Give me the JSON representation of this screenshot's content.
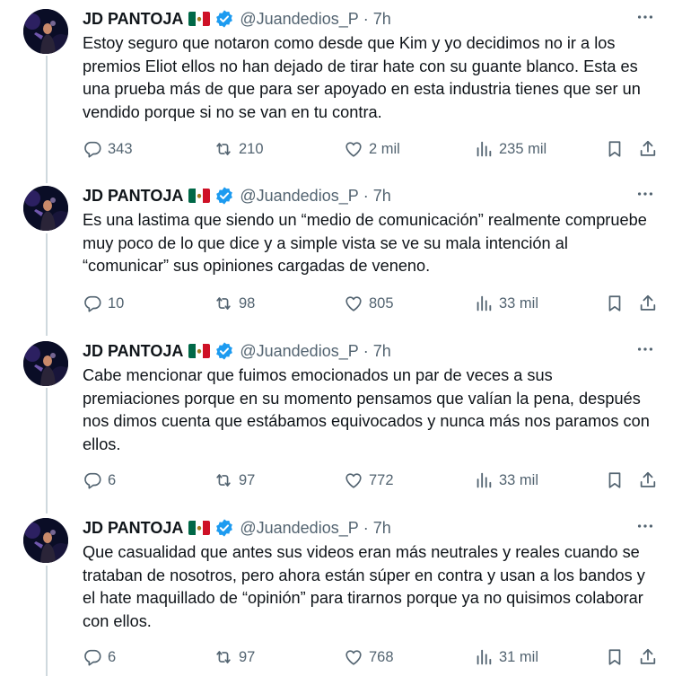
{
  "author": {
    "name": "JD PANTOJA",
    "handle": "@Juandedios_P",
    "separator": "·",
    "flag_icon": "mexico-flag-icon",
    "verified_icon": "verified-badge-icon",
    "verified_color": "#1d9bf0"
  },
  "icons": {
    "more": "more-options-icon",
    "reply": "reply-icon",
    "retweet": "retweet-icon",
    "like": "like-icon",
    "views": "views-icon",
    "bookmark": "bookmark-icon",
    "share": "share-icon"
  },
  "tweets": [
    {
      "time": "7h",
      "text": "Estoy seguro que notaron como desde que Kim y yo decidimos no ir a los premios Eliot ellos no han dejado de tirar hate con su guante blanco. Esta es una prueba más de que para ser apoyado en esta industria tienes que ser un vendido porque si no se van en tu contra.",
      "replies": "343",
      "retweets": "210",
      "likes": "2 mil",
      "views": "235 mil"
    },
    {
      "time": "7h",
      "text": "Es una lastima que siendo un “medio de comunicación” realmente compruebe muy poco de lo que dice y a simple vista se ve su mala intención al “comunicar” sus opiniones cargadas de veneno.",
      "replies": "10",
      "retweets": "98",
      "likes": "805",
      "views": "33 mil"
    },
    {
      "time": "7h",
      "text": "Cabe mencionar que fuimos emocionados un par de veces a sus premiaciones porque en su momento pensamos que valían la pena, después nos dimos cuenta que estábamos equivocados y nunca más nos paramos con ellos.",
      "replies": "6",
      "retweets": "97",
      "likes": "772",
      "views": "33 mil"
    },
    {
      "time": "7h",
      "text": "Que casualidad que antes sus videos eran más neutrales y reales cuando se trataban de nosotros, pero ahora están súper en contra y usan a los bandos y el hate maquillado de “opinión” para tirarnos porque ya no quisimos colaborar con ellos.",
      "replies": "6",
      "retweets": "97",
      "likes": "768",
      "views": "31 mil"
    }
  ]
}
